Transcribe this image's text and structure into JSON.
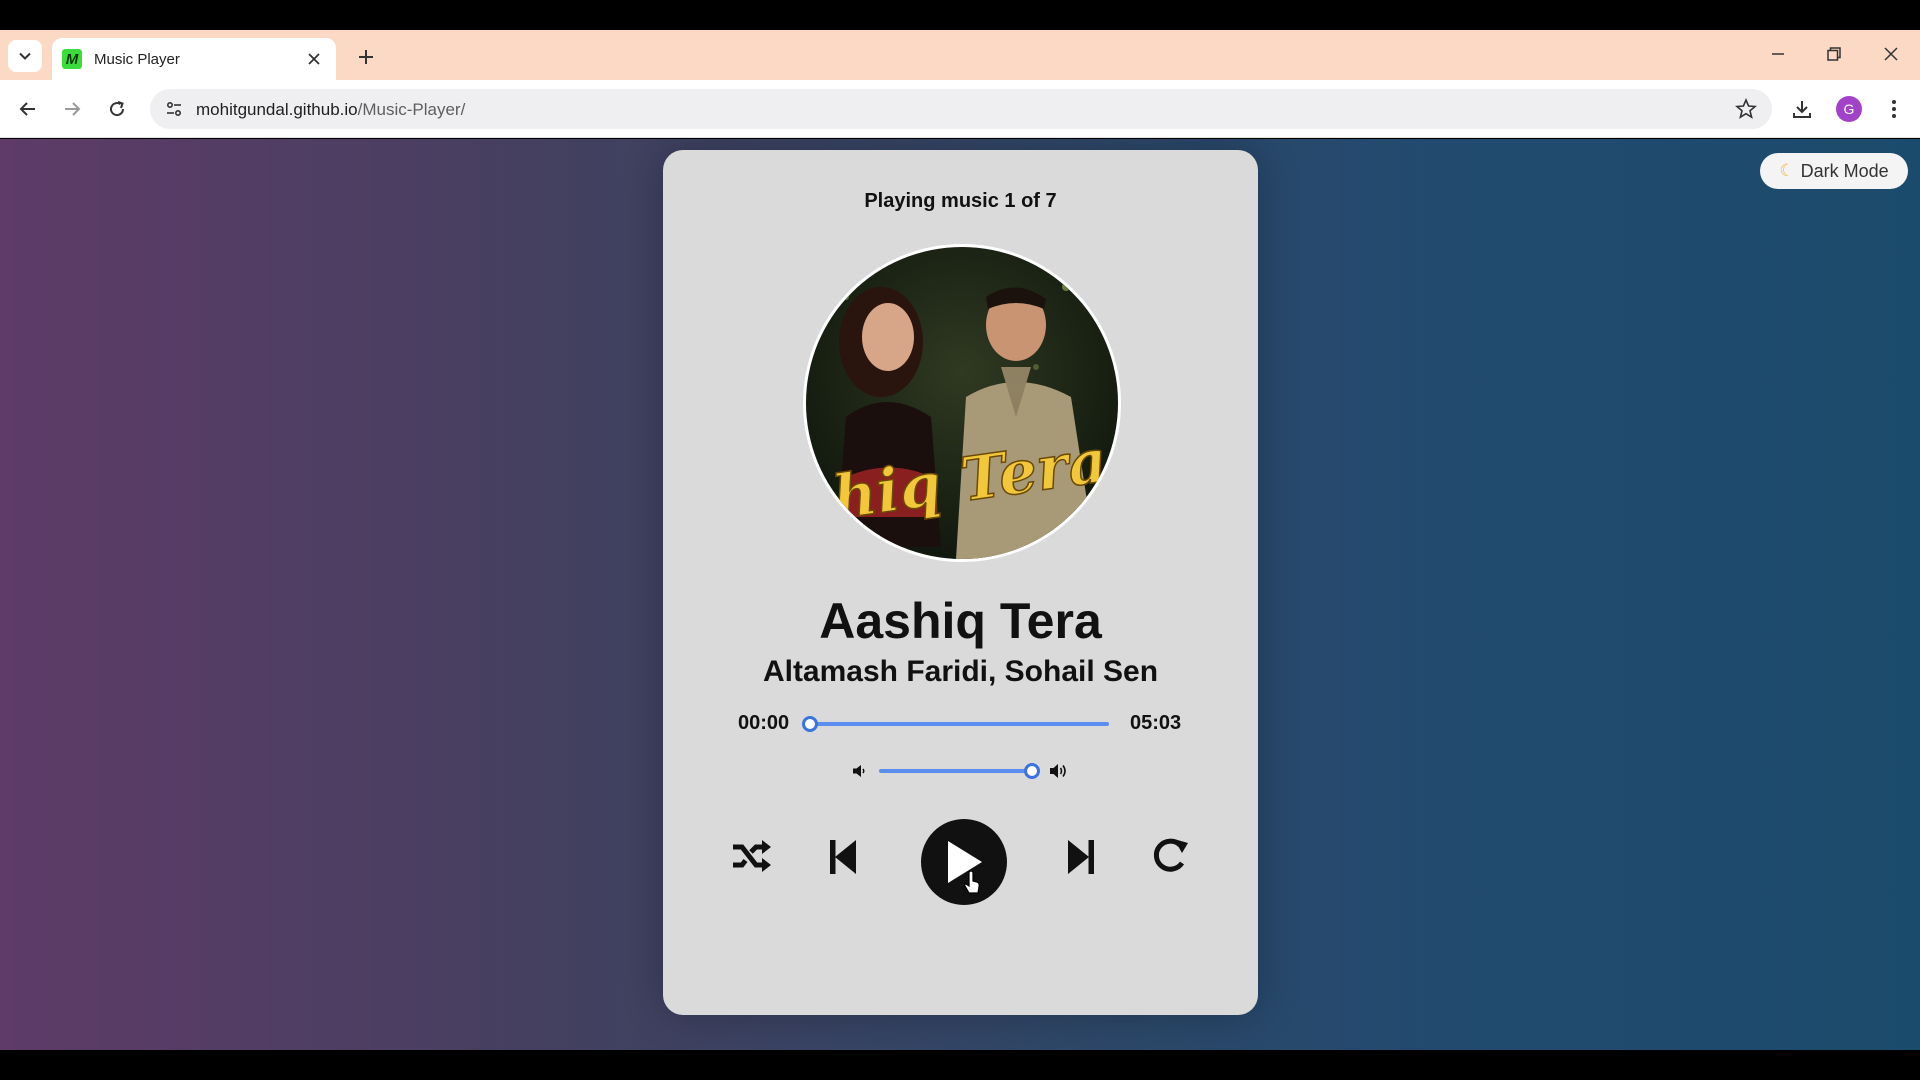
{
  "browser": {
    "tab_title": "Music Player",
    "tab_favicon_letter": "M",
    "url_host": "mohitgundal.github.io",
    "url_path": "/Music-Player/",
    "profile_initial": "G"
  },
  "page": {
    "dark_mode_label": "Dark Mode",
    "dark_mode_icon": "moon-icon",
    "playing_status": "Playing music 1 of 7",
    "album_art_text": "shiq Tera",
    "song_title": "Aashiq Tera",
    "artist": "Altamash Faridi, Sohail Sen",
    "current_time": "00:00",
    "duration": "05:03",
    "progress": 0,
    "volume": 1.0,
    "controls": [
      "shuffle-icon",
      "previous-icon",
      "play-icon",
      "next-icon",
      "repeat-icon"
    ],
    "accent_color": "#3b72e0"
  }
}
